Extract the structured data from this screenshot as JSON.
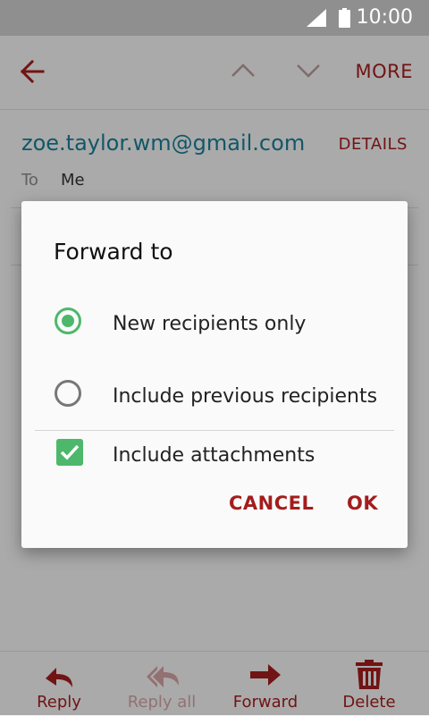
{
  "status_bar": {
    "time": "10:00",
    "icons": [
      "signal-icon",
      "battery-icon"
    ]
  },
  "app_bar": {
    "more_label": "MORE",
    "icons": [
      "back-arrow-icon",
      "chevron-up-icon",
      "chevron-down-icon"
    ]
  },
  "email": {
    "sender": "zoe.taylor.wm@gmail.com",
    "details_label": "DETAILS",
    "to_label": "To",
    "to_value": "Me"
  },
  "dialog": {
    "title": "Forward to",
    "options": [
      {
        "label": "New recipients only",
        "selected": true
      },
      {
        "label": "Include previous recipients",
        "selected": false
      }
    ],
    "include_attachments": {
      "label": "Include attachments",
      "checked": true
    },
    "cancel_label": "CANCEL",
    "ok_label": "OK"
  },
  "toolbar": {
    "items": [
      {
        "label": "Reply",
        "icon": "reply-icon",
        "enabled": true
      },
      {
        "label": "Reply all",
        "icon": "reply-all-icon",
        "enabled": false
      },
      {
        "label": "Forward",
        "icon": "forward-icon",
        "enabled": true
      },
      {
        "label": "Delete",
        "icon": "trash-icon",
        "enabled": true
      }
    ]
  },
  "colors": {
    "accent": "#a31d1d",
    "link": "#1b7d96",
    "check_green": "#4db86b"
  }
}
